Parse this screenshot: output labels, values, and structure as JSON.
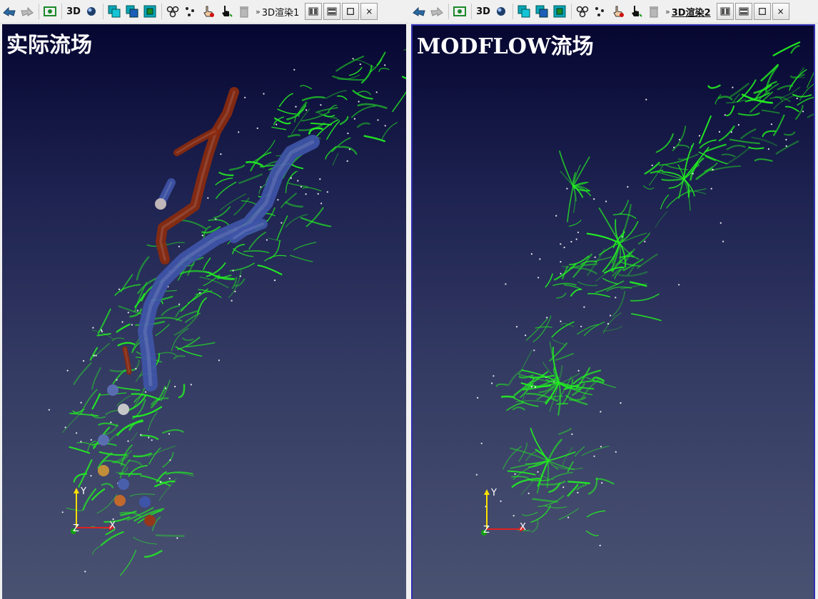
{
  "toolbar_left": {
    "three_d_label": "3D",
    "more_label": "»",
    "view_title": "3D渲染1",
    "active": false
  },
  "toolbar_right": {
    "three_d_label": "3D",
    "more_label": "»",
    "view_title": "3D渲染2",
    "active": true
  },
  "window_buttons": {
    "close_label": "×"
  },
  "viewport_left": {
    "title": "实际流场",
    "axis_x": "X",
    "axis_y": "Y",
    "axis_z": "Z"
  },
  "viewport_right": {
    "title": "MODFLOW流场",
    "axis_x": "X",
    "axis_y": "Y",
    "axis_z": "Z"
  },
  "colors": {
    "streamline": "#22ee22",
    "tube_blue": "#3f55a8",
    "tube_red": "#8a2a0e",
    "axis_x": "#e02020",
    "axis_y": "#ffe000",
    "axis_z": "#10a010",
    "active_border": "#2f2fb0"
  },
  "icons": [
    "pan-left-icon",
    "pan-right-icon",
    "screenshot-icon",
    "3d-view-icon",
    "sphere-icon",
    "layer-cyan-icon",
    "layer-blue-icon",
    "layer-green-icon",
    "nodes-icon",
    "points-icon",
    "hand-pointer-icon",
    "pointer-icon",
    "trash-icon",
    "split-vertical-icon",
    "split-horizontal-icon",
    "maximize-icon",
    "close-icon"
  ]
}
